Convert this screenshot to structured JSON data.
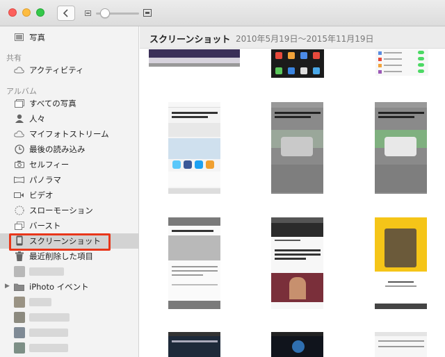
{
  "toolbar": {
    "back_icon": "chevron-left-icon",
    "zoom_out_icon": "small-photo-icon",
    "zoom_in_icon": "large-photo-icon",
    "zoom_level": 0.15
  },
  "sidebar": {
    "photos_label": "写真",
    "shared_header": "共有",
    "activity_label": "アクティビティ",
    "albums_header": "アルバム",
    "items": [
      {
        "label": "すべての写真",
        "icon": "photos-stack-icon"
      },
      {
        "label": "人々",
        "icon": "person-icon"
      },
      {
        "label": "マイフォトストリーム",
        "icon": "cloud-icon"
      },
      {
        "label": "最後の読み込み",
        "icon": "clock-icon"
      },
      {
        "label": "セルフィー",
        "icon": "camera-icon"
      },
      {
        "label": "パノラマ",
        "icon": "panorama-icon"
      },
      {
        "label": "ビデオ",
        "icon": "video-icon"
      },
      {
        "label": "スローモーション",
        "icon": "slowmo-icon"
      },
      {
        "label": "バースト",
        "icon": "burst-icon"
      },
      {
        "label": "スクリーンショット",
        "icon": "screenshot-icon"
      },
      {
        "label": "最近削除した項目",
        "icon": "trash-icon"
      }
    ],
    "iphoto_label": "iPhoto イベント"
  },
  "main": {
    "title": "スクリーンショット",
    "date_range": "2010年5月19日〜2015年11月19日"
  },
  "colors": {
    "highlight": "#e8361a",
    "selected_row": "#d3d3d3",
    "sidebar_bg": "#f3f3f3"
  }
}
